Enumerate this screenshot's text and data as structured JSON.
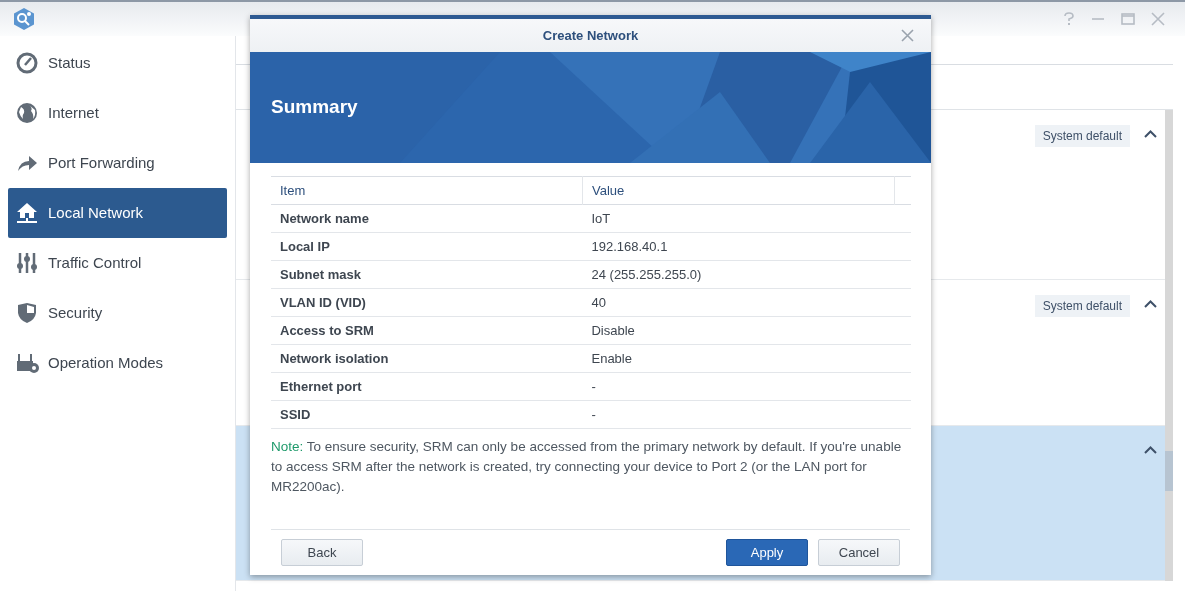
{
  "sidebar": {
    "items": [
      {
        "label": "Status",
        "selected": false
      },
      {
        "label": "Internet",
        "selected": false
      },
      {
        "label": "Port Forwarding",
        "selected": false
      },
      {
        "label": "Local Network",
        "selected": true
      },
      {
        "label": "Traffic Control",
        "selected": false
      },
      {
        "label": "Security",
        "selected": false
      },
      {
        "label": "Operation Modes",
        "selected": false
      }
    ]
  },
  "panels": [
    {
      "badge": "System default",
      "selected": false
    },
    {
      "badge": "System default",
      "selected": false
    },
    {
      "selected": true
    }
  ],
  "dialog": {
    "title": "Create Network",
    "heading": "Summary",
    "columns": [
      "Item",
      "Value"
    ],
    "rows": [
      {
        "item": "Network name",
        "value": "IoT"
      },
      {
        "item": "Local IP",
        "value": "192.168.40.1"
      },
      {
        "item": "Subnet mask",
        "value": "24 (255.255.255.0)"
      },
      {
        "item": "VLAN ID (VID)",
        "value": "40"
      },
      {
        "item": "Access to SRM",
        "value": "Disable"
      },
      {
        "item": "Network isolation",
        "value": "Enable"
      },
      {
        "item": "Ethernet port",
        "value": "-"
      },
      {
        "item": "SSID",
        "value": "-"
      }
    ],
    "note": "**Note:** To ensure security, SRM can only be accessed from the primary network by default. If you're unable to access SRM after the network is created, try connecting your device to Port 2 (or the LAN port for MR2200ac).",
    "buttons": [
      {
        "label": "Back",
        "kind": "secondary"
      },
      {
        "label": "Apply",
        "kind": "primary"
      },
      {
        "label": "Cancel",
        "kind": "secondary"
      }
    ]
  }
}
